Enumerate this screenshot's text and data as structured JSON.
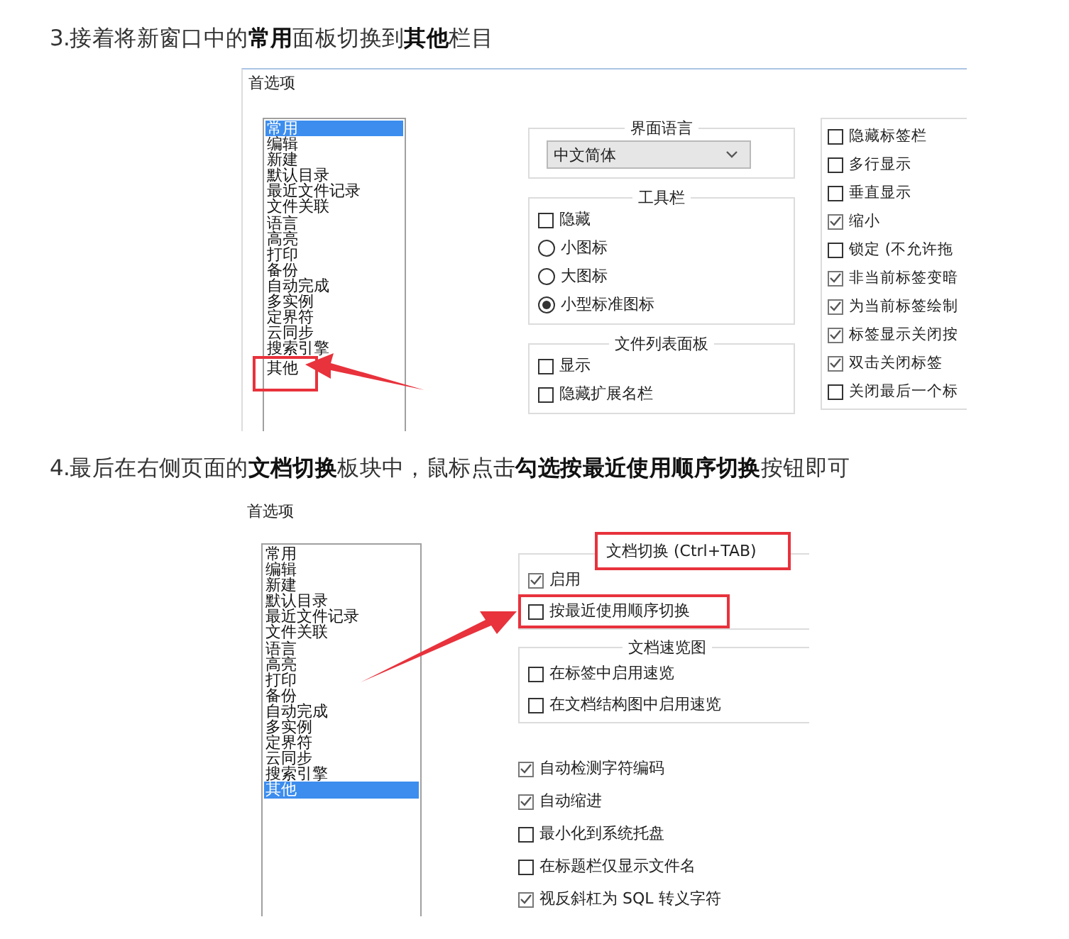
{
  "sections": [
    {
      "heading": "3.接着将新窗口中的**常用**面板切换到**其他**栏目",
      "dialog": {
        "title": "首选项",
        "categories": [
          {
            "label": "常用",
            "selected": true,
            "highlighted": false
          },
          {
            "label": "编辑",
            "selected": false,
            "highlighted": false
          },
          {
            "label": "新建",
            "selected": false,
            "highlighted": false
          },
          {
            "label": "默认目录",
            "selected": false,
            "highlighted": false
          },
          {
            "label": "最近文件记录",
            "selected": false,
            "highlighted": false
          },
          {
            "label": "文件关联",
            "selected": false,
            "highlighted": false
          },
          {
            "label": "语言",
            "selected": false,
            "highlighted": false
          },
          {
            "label": "高亮",
            "selected": false,
            "highlighted": false
          },
          {
            "label": "打印",
            "selected": false,
            "highlighted": false
          },
          {
            "label": "备份",
            "selected": false,
            "highlighted": false
          },
          {
            "label": "自动完成",
            "selected": false,
            "highlighted": false
          },
          {
            "label": "多实例",
            "selected": false,
            "highlighted": false
          },
          {
            "label": "定界符",
            "selected": false,
            "highlighted": false
          },
          {
            "label": "云同步",
            "selected": false,
            "highlighted": false
          },
          {
            "label": "搜索引擎",
            "selected": false,
            "highlighted": false
          },
          {
            "label": "其他",
            "selected": false,
            "highlighted": true
          }
        ],
        "columns": [
          [
            {
              "kind": "group",
              "legend": "界面语言",
              "legend_highlighted": false,
              "items": [
                {
                  "kind": "select",
                  "label": "中文简体"
                }
              ]
            },
            {
              "kind": "group",
              "legend": "工具栏",
              "legend_highlighted": false,
              "items": [
                {
                  "kind": "checkbox",
                  "label": "隐藏",
                  "checked": false,
                  "highlighted": false
                },
                {
                  "kind": "radio",
                  "label": "小图标",
                  "checked": false,
                  "highlighted": false
                },
                {
                  "kind": "radio",
                  "label": "大图标",
                  "checked": false,
                  "highlighted": false
                },
                {
                  "kind": "radio",
                  "label": "小型标准图标",
                  "checked": true,
                  "highlighted": false
                }
              ]
            },
            {
              "kind": "group",
              "legend": "文件列表面板",
              "legend_highlighted": false,
              "items": [
                {
                  "kind": "checkbox",
                  "label": "显示",
                  "checked": false,
                  "highlighted": false
                },
                {
                  "kind": "checkbox",
                  "label": "隐藏扩展名栏",
                  "checked": false,
                  "highlighted": false
                }
              ]
            }
          ],
          [
            {
              "kind": "group",
              "items": [
                {
                  "kind": "checkbox",
                  "label": "隐藏标签栏",
                  "checked": false,
                  "highlighted": false
                },
                {
                  "kind": "checkbox",
                  "label": "多行显示",
                  "checked": false,
                  "highlighted": false
                },
                {
                  "kind": "checkbox",
                  "label": "垂直显示",
                  "checked": false,
                  "highlighted": false
                },
                {
                  "kind": "checkbox",
                  "label": "缩小",
                  "checked": true,
                  "highlighted": false
                },
                {
                  "kind": "checkbox",
                  "label": "锁定 (不允许拖",
                  "checked": false,
                  "highlighted": false
                },
                {
                  "kind": "checkbox",
                  "label": "非当前标签变暗",
                  "checked": true,
                  "highlighted": false
                },
                {
                  "kind": "checkbox",
                  "label": "为当前标签绘制",
                  "checked": true,
                  "highlighted": false
                },
                {
                  "kind": "checkbox",
                  "label": "标签显示关闭按",
                  "checked": true,
                  "highlighted": false
                },
                {
                  "kind": "checkbox",
                  "label": "双击关闭标签",
                  "checked": true,
                  "highlighted": false
                },
                {
                  "kind": "checkbox",
                  "label": "关闭最后一个标",
                  "checked": false,
                  "highlighted": false
                }
              ]
            }
          ]
        ]
      }
    },
    {
      "heading": "4.最后在右侧页面的**文档切换**板块中，鼠标点击**勾选按最近使用顺序切换**按钮即可",
      "dialog": {
        "title": "首选项",
        "categories": [
          {
            "label": "常用",
            "selected": false,
            "highlighted": false
          },
          {
            "label": "编辑",
            "selected": false,
            "highlighted": false
          },
          {
            "label": "新建",
            "selected": false,
            "highlighted": false
          },
          {
            "label": "默认目录",
            "selected": false,
            "highlighted": false
          },
          {
            "label": "最近文件记录",
            "selected": false,
            "highlighted": false
          },
          {
            "label": "文件关联",
            "selected": false,
            "highlighted": false
          },
          {
            "label": "语言",
            "selected": false,
            "highlighted": false
          },
          {
            "label": "高亮",
            "selected": false,
            "highlighted": false
          },
          {
            "label": "打印",
            "selected": false,
            "highlighted": false
          },
          {
            "label": "备份",
            "selected": false,
            "highlighted": false
          },
          {
            "label": "自动完成",
            "selected": false,
            "highlighted": false
          },
          {
            "label": "多实例",
            "selected": false,
            "highlighted": false
          },
          {
            "label": "定界符",
            "selected": false,
            "highlighted": false
          },
          {
            "label": "云同步",
            "selected": false,
            "highlighted": false
          },
          {
            "label": "搜索引擎",
            "selected": false,
            "highlighted": false
          },
          {
            "label": "其他",
            "selected": true,
            "highlighted": false
          }
        ],
        "columns": [
          [
            {
              "kind": "group",
              "legend": "文档切换 (Ctrl+TAB)",
              "legend_highlighted": true,
              "items": [
                {
                  "kind": "checkbox",
                  "label": "启用",
                  "checked": true,
                  "highlighted": false
                },
                {
                  "kind": "checkbox",
                  "label": "按最近使用顺序切换",
                  "checked": false,
                  "highlighted": true
                }
              ]
            },
            {
              "kind": "group",
              "legend": "文档速览图",
              "legend_highlighted": false,
              "items": [
                {
                  "kind": "checkbox",
                  "label": "在标签中启用速览",
                  "checked": false,
                  "highlighted": false
                },
                {
                  "kind": "checkbox",
                  "label": "在文档结构图中启用速览",
                  "checked": false,
                  "highlighted": false
                }
              ]
            },
            {
              "kind": "plain",
              "items": [
                {
                  "kind": "checkbox",
                  "label": "自动检测字符编码",
                  "checked": true,
                  "highlighted": false
                },
                {
                  "kind": "checkbox",
                  "label": "自动缩进",
                  "checked": true,
                  "highlighted": false
                },
                {
                  "kind": "checkbox",
                  "label": "最小化到系统托盘",
                  "checked": false,
                  "highlighted": false
                },
                {
                  "kind": "checkbox",
                  "label": "在标题栏仅显示文件名",
                  "checked": false,
                  "highlighted": false
                },
                {
                  "kind": "checkbox",
                  "label": "视反斜杠为 SQL 转义字符",
                  "checked": true,
                  "highlighted": false
                }
              ]
            }
          ]
        ]
      }
    }
  ]
}
